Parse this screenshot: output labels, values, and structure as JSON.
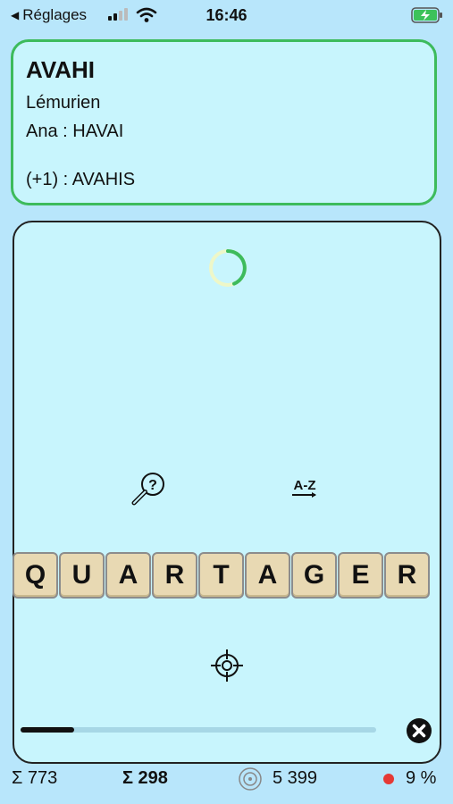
{
  "status_bar": {
    "back_label": "Réglages",
    "time": "16:46"
  },
  "card": {
    "word": "AVAHI",
    "definition": "Lémurien",
    "anagram": "Ana : HAVAI",
    "extension": "(+1) : AVAHIS"
  },
  "panel": {
    "az_label": "A-Z",
    "tiles": [
      "Q",
      "U",
      "A",
      "R",
      "T",
      "A",
      "G",
      "E",
      "R"
    ],
    "progress": 0.15
  },
  "stats": {
    "total": "Σ 773",
    "current": "Σ 298",
    "score": "5 399",
    "percent": "9 %"
  },
  "colors": {
    "background": "#b8e6fb",
    "card_border": "#3dbb5c",
    "panel_bg": "#c8f5fd",
    "tile_bg": "#e8d9b3",
    "dot": "#e53935"
  }
}
